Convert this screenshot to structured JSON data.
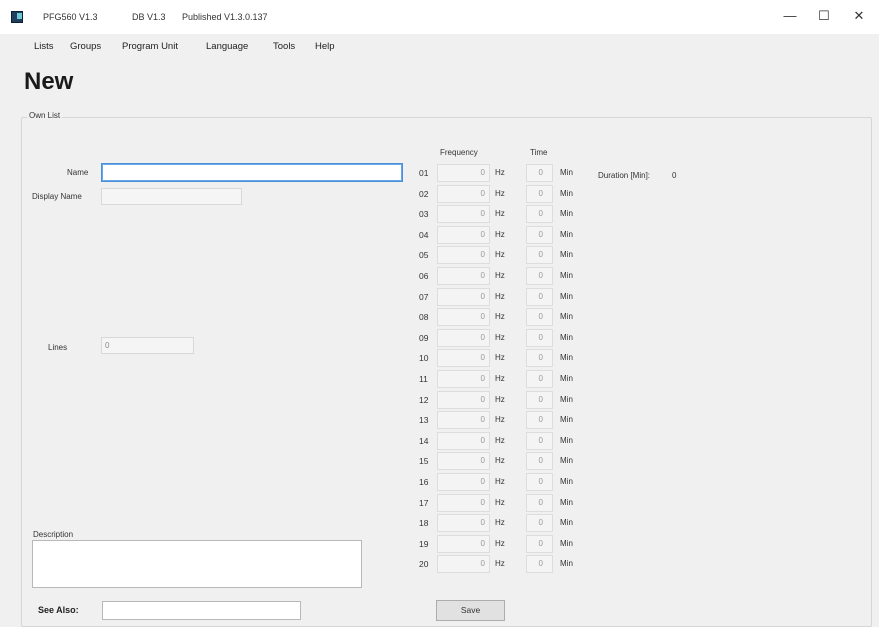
{
  "titlebar": {
    "app_name": "PFG560 V1.3",
    "db_version": "DB V1.3",
    "published": "Published V1.3.0.137",
    "minimize": "—",
    "maximize": "☐",
    "close": "✕"
  },
  "menu": [
    "Lists",
    "Groups",
    "Program Unit",
    "Language",
    "Tools",
    "Help"
  ],
  "page_title": "New",
  "group_legend": "Own List",
  "form": {
    "name_label": "Name",
    "name_value": "",
    "display_name_label": "Display Name",
    "display_name_value": "",
    "lines_label": "Lines",
    "lines_value": "0",
    "description_label": "Description",
    "see_also_label": "See Also:",
    "see_also_value": ""
  },
  "program": {
    "frequency_header": "Frequency",
    "time_header": "Time",
    "duration_label": "Duration [Min]:",
    "duration_value": "0",
    "hz_unit": "Hz",
    "min_unit": "Min",
    "rows": [
      {
        "num": "01",
        "freq": "0",
        "time": "0"
      },
      {
        "num": "02",
        "freq": "0",
        "time": "0"
      },
      {
        "num": "03",
        "freq": "0",
        "time": "0"
      },
      {
        "num": "04",
        "freq": "0",
        "time": "0"
      },
      {
        "num": "05",
        "freq": "0",
        "time": "0"
      },
      {
        "num": "06",
        "freq": "0",
        "time": "0"
      },
      {
        "num": "07",
        "freq": "0",
        "time": "0"
      },
      {
        "num": "08",
        "freq": "0",
        "time": "0"
      },
      {
        "num": "09",
        "freq": "0",
        "time": "0"
      },
      {
        "num": "10",
        "freq": "0",
        "time": "0"
      },
      {
        "num": "11",
        "freq": "0",
        "time": "0"
      },
      {
        "num": "12",
        "freq": "0",
        "time": "0"
      },
      {
        "num": "13",
        "freq": "0",
        "time": "0"
      },
      {
        "num": "14",
        "freq": "0",
        "time": "0"
      },
      {
        "num": "15",
        "freq": "0",
        "time": "0"
      },
      {
        "num": "16",
        "freq": "0",
        "time": "0"
      },
      {
        "num": "17",
        "freq": "0",
        "time": "0"
      },
      {
        "num": "18",
        "freq": "0",
        "time": "0"
      },
      {
        "num": "19",
        "freq": "0",
        "time": "0"
      },
      {
        "num": "20",
        "freq": "0",
        "time": "0"
      }
    ]
  },
  "save_label": "Save"
}
